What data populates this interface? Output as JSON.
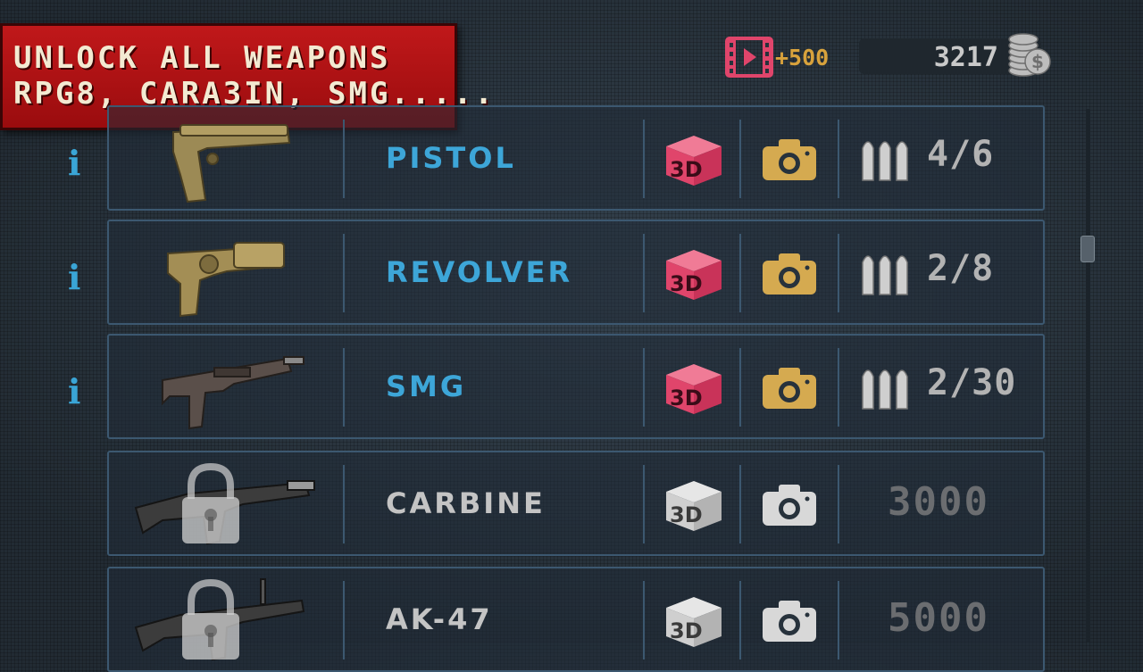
{
  "banner": {
    "line1": "UNLOCK ALL WEAPONS",
    "line2": "RPG8, CARA3IN, SMG....."
  },
  "video_reward": {
    "icon": "film-play-icon",
    "label": "+500"
  },
  "coins": {
    "icon": "coin-stack-icon",
    "amount": "3217"
  },
  "weapons": [
    {
      "name": "PISTOL",
      "state": "unlocked",
      "ammo": "4/6",
      "info": "i",
      "cube_label": "3D"
    },
    {
      "name": "REVOLVER",
      "state": "unlocked",
      "ammo": "2/8",
      "info": "i",
      "cube_label": "3D"
    },
    {
      "name": "SMG",
      "state": "unlocked",
      "ammo": "2/30",
      "info": "i",
      "cube_label": "3D"
    },
    {
      "name": "CARBINE",
      "state": "locked",
      "price": "3000",
      "cube_label": "3D"
    },
    {
      "name": "AK-47",
      "state": "locked",
      "price": "5000",
      "cube_label": "3D"
    }
  ],
  "colors": {
    "accent_blue": "#3da6d8",
    "cube_pink": "#e0456b",
    "camera_gold": "#d5aa50",
    "banner_red": "#b31214",
    "locked_gray": "#c4c4c4"
  }
}
